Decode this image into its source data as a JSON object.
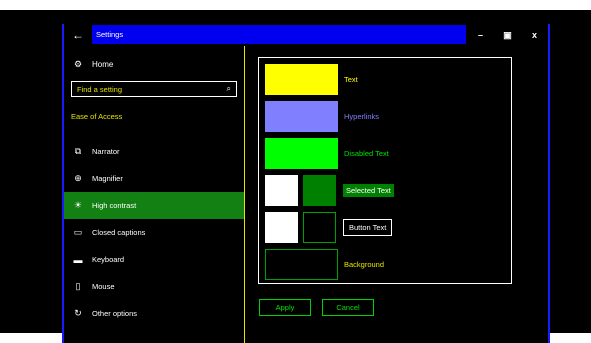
{
  "window": {
    "title": "Settings",
    "back_icon": "arrow-left-icon",
    "controls": {
      "minimize": "–",
      "maximize": "▣",
      "close": "x"
    }
  },
  "sidebar": {
    "home_label": "Home",
    "search_placeholder": "Find a setting",
    "section_title": "Ease of Access",
    "items": [
      {
        "label": "Narrator",
        "icon": "narrator-icon",
        "glyph": "⧉"
      },
      {
        "label": "Magnifier",
        "icon": "magnifier-icon",
        "glyph": "⊕"
      },
      {
        "label": "High contrast",
        "icon": "sun-icon",
        "glyph": "☀",
        "active": true
      },
      {
        "label": "Closed captions",
        "icon": "captions-icon",
        "glyph": "▭"
      },
      {
        "label": "Keyboard",
        "icon": "keyboard-icon",
        "glyph": "▬"
      },
      {
        "label": "Mouse",
        "icon": "mouse-icon",
        "glyph": "▯"
      },
      {
        "label": "Other options",
        "icon": "other-options-icon",
        "glyph": "↻"
      }
    ]
  },
  "colors_panel": {
    "text_label": "Text",
    "hyperlinks_label": "Hyperlinks",
    "disabled_text_label": "Disabled Text",
    "selected_text_label": "Selected Text",
    "button_text_label": "Button Text",
    "background_label": "Background",
    "colors": {
      "text": "#ffff00",
      "hyperlinks": "#8080ff",
      "disabled_text": "#00ff00",
      "selected_text_bg": "#008000",
      "selected_text_fg": "#ffffff",
      "button_face": "#000000",
      "button_text": "#ffffff",
      "background": "#000000",
      "accent_title": "#0000ee",
      "active_nav": "#128012"
    }
  },
  "actions": {
    "apply_label": "Apply",
    "cancel_label": "Cancel"
  }
}
